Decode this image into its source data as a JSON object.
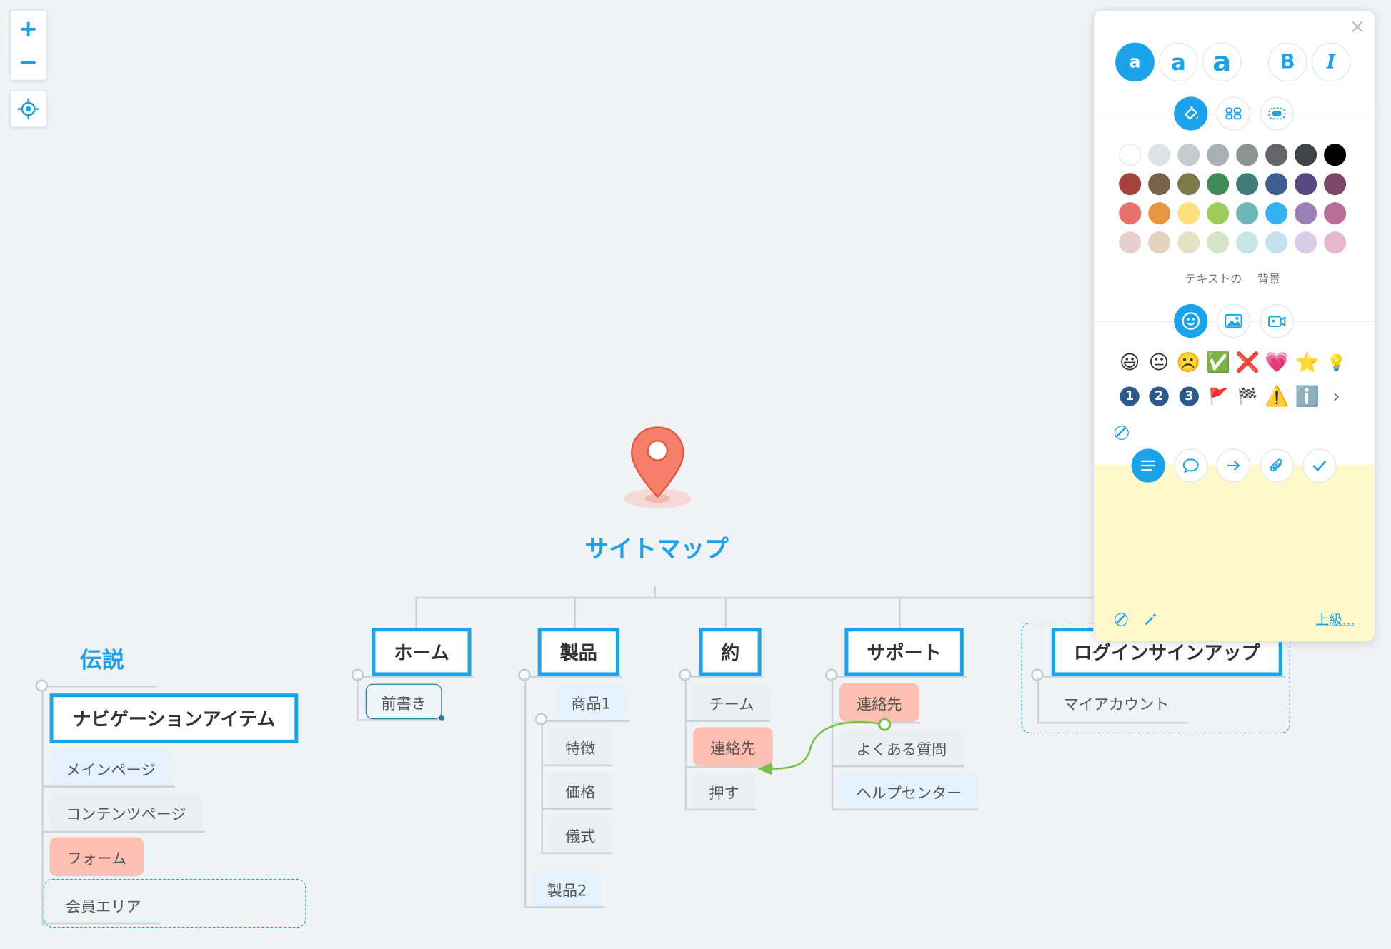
{
  "controls": {
    "zoom_in": "+",
    "zoom_out": "−"
  },
  "map": {
    "title": "サイトマップ",
    "branches": [
      {
        "label": "ホーム",
        "children": [
          "前書き"
        ]
      },
      {
        "label": "製品",
        "children": [
          "商品1",
          "特徴",
          "価格",
          "儀式",
          "製品2"
        ]
      },
      {
        "label": "約",
        "children": [
          "チーム",
          "連絡先",
          "押す"
        ]
      },
      {
        "label": "サポート",
        "children": [
          "連絡先",
          "よくある質問",
          "ヘルプセンター"
        ]
      },
      {
        "label": "ログインサインアップ",
        "children": [
          "マイアカウント"
        ]
      }
    ]
  },
  "legend": {
    "title": "伝説",
    "topic": "ナビゲーションアイテム",
    "items": [
      "メインページ",
      "コンテンツページ",
      "フォーム",
      "会員エリア"
    ]
  },
  "panel": {
    "close": "×",
    "font_sizes": [
      "a",
      "a",
      "a"
    ],
    "bold": "B",
    "italic": "I",
    "color_targets": [
      "テキストの",
      "背景"
    ],
    "palette": [
      [
        "#ffffff",
        "#dde2e6",
        "#c4cbcf",
        "#a9b0b3",
        "#8d9295",
        "#626669",
        "#3f4447",
        "#000000"
      ],
      [
        "#a6413b",
        "#7a614b",
        "#7d7b4c",
        "#418a55",
        "#3e7d7c",
        "#3d5f8f",
        "#574a83",
        "#7b4968"
      ],
      [
        "#e8716c",
        "#e89542",
        "#fadf7a",
        "#9fca5c",
        "#6db8b4",
        "#33b2f2",
        "#9a80b9",
        "#b86e96"
      ],
      [
        "#e7cfd0",
        "#e2d3bf",
        "#e4e1c5",
        "#d5e4c9",
        "#c8e5e5",
        "#c5e0ef",
        "#d9cce9",
        "#e7b8cd"
      ]
    ],
    "emojis": [
      "😃",
      "😐",
      "☹️",
      "✅",
      "❌",
      "💗",
      "⭐",
      "💡"
    ],
    "icons_row2_numbers": [
      "1",
      "2",
      "3"
    ],
    "icons_row2_extra": [
      "🚩",
      "🏁",
      "⚠️",
      "ℹ️",
      "›"
    ],
    "advanced": "上級..."
  }
}
